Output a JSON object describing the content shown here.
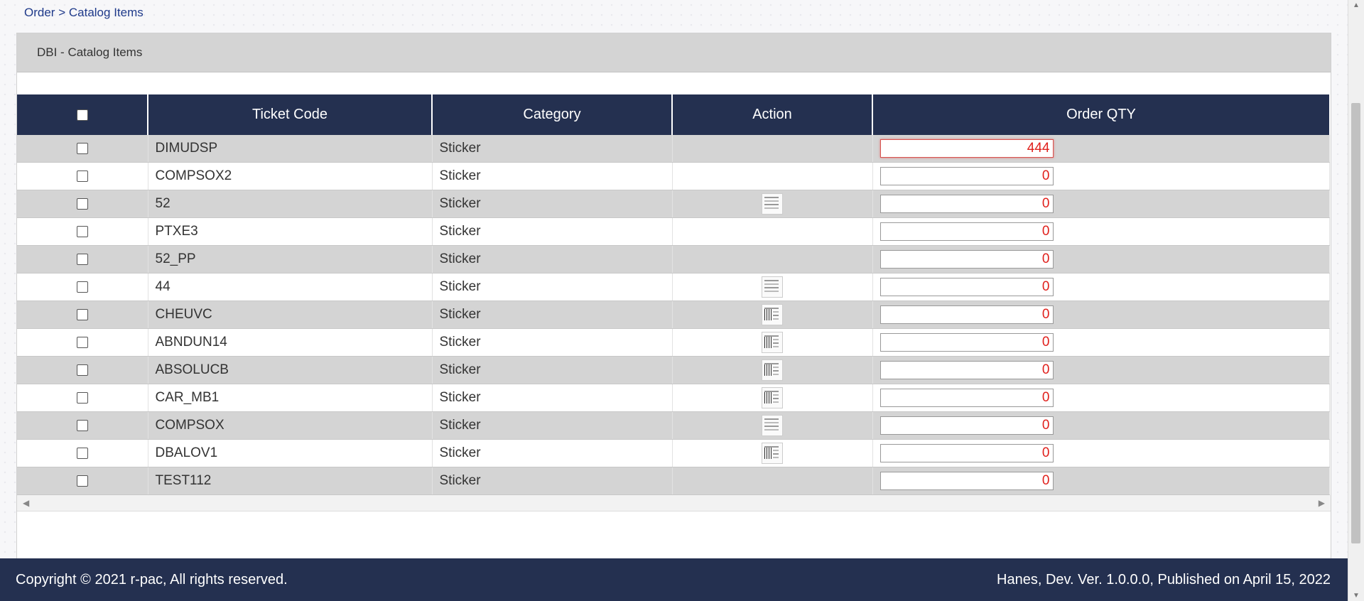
{
  "breadcrumb": {
    "parent": "Order",
    "separator": ">",
    "current": "Catalog Items"
  },
  "panel": {
    "title": "DBI - Catalog Items"
  },
  "table": {
    "headers": {
      "ticket_code": "Ticket Code",
      "category": "Category",
      "action": "Action",
      "order_qty": "Order QTY"
    },
    "rows": [
      {
        "ticket_code": "DIMUDSP",
        "category": "Sticker",
        "thumb": "",
        "qty": "444"
      },
      {
        "ticket_code": "COMPSOX2",
        "category": "Sticker",
        "thumb": "",
        "qty": "0"
      },
      {
        "ticket_code": "52",
        "category": "Sticker",
        "thumb": "doc",
        "qty": "0"
      },
      {
        "ticket_code": "PTXE3",
        "category": "Sticker",
        "thumb": "",
        "qty": "0"
      },
      {
        "ticket_code": "52_PP",
        "category": "Sticker",
        "thumb": "",
        "qty": "0"
      },
      {
        "ticket_code": "44",
        "category": "Sticker",
        "thumb": "doc",
        "qty": "0"
      },
      {
        "ticket_code": "CHEUVC",
        "category": "Sticker",
        "thumb": "bar",
        "qty": "0"
      },
      {
        "ticket_code": "ABNDUN14",
        "category": "Sticker",
        "thumb": "bar",
        "qty": "0"
      },
      {
        "ticket_code": "ABSOLUCB",
        "category": "Sticker",
        "thumb": "bar",
        "qty": "0"
      },
      {
        "ticket_code": "CAR_MB1",
        "category": "Sticker",
        "thumb": "bar",
        "qty": "0"
      },
      {
        "ticket_code": "COMPSOX",
        "category": "Sticker",
        "thumb": "doc",
        "qty": "0"
      },
      {
        "ticket_code": "DBALOV1",
        "category": "Sticker",
        "thumb": "bar",
        "qty": "0"
      },
      {
        "ticket_code": "TEST112",
        "category": "Sticker",
        "thumb": "",
        "qty": "0"
      }
    ]
  },
  "footer": {
    "copyright": "Copyright © 2021 r-pac, All rights reserved.",
    "version": "Hanes, Dev. Ver. 1.0.0.0, Published on April 15, 2022"
  },
  "colors": {
    "header_bg": "#243050",
    "qty_text": "#e0201c",
    "row_alt": "#d4d4d4"
  },
  "icons": {
    "scroll_left": "◀",
    "scroll_right": "▶",
    "scroll_up": "▲",
    "scroll_down": "▼"
  }
}
